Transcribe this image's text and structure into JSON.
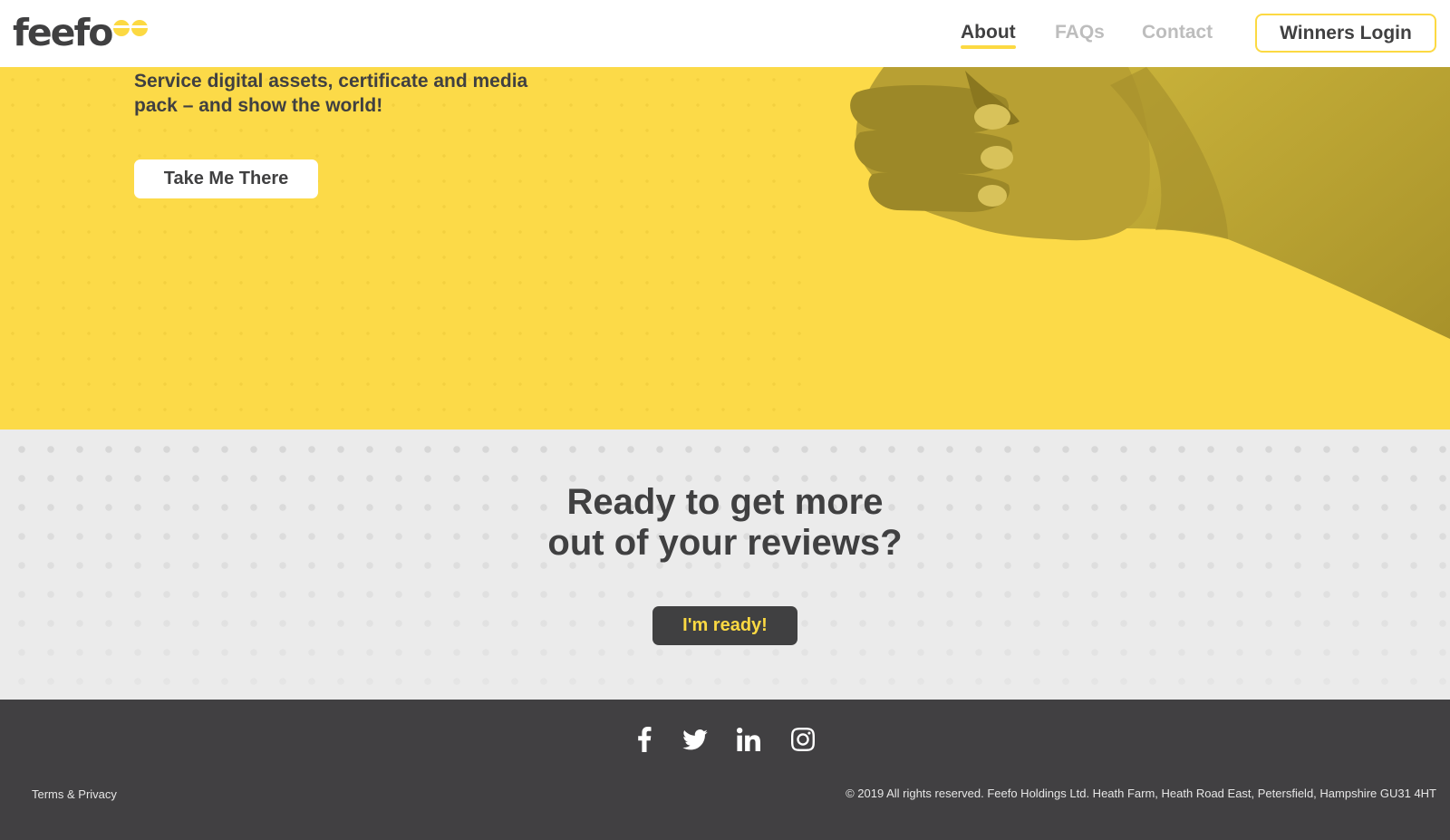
{
  "header": {
    "logo_text": "feefo",
    "nav": [
      {
        "label": "About",
        "active": true
      },
      {
        "label": "FAQs",
        "active": false
      },
      {
        "label": "Contact",
        "active": false
      }
    ],
    "login_label": "Winners Login"
  },
  "hero": {
    "text": "Service digital assets, certificate and media pack – and show the world!",
    "button_label": "Take Me There",
    "image": "thumbs-up-hand"
  },
  "cta": {
    "title_line1": "Ready to get more",
    "title_line2": "out of your reviews?",
    "button_label": "I'm ready!"
  },
  "footer": {
    "social": [
      "facebook-icon",
      "twitter-icon",
      "linkedin-icon",
      "instagram-icon"
    ],
    "terms_label": "Terms & Privacy",
    "copyright": "© 2019 All rights reserved. Feefo Holdings Ltd. Heath Farm, Heath Road East, Petersfield, Hampshire GU31 4HT"
  },
  "colors": {
    "brand_yellow": "#FCDA48",
    "dark": "#404041",
    "muted_nav": "#BDBDBD"
  }
}
